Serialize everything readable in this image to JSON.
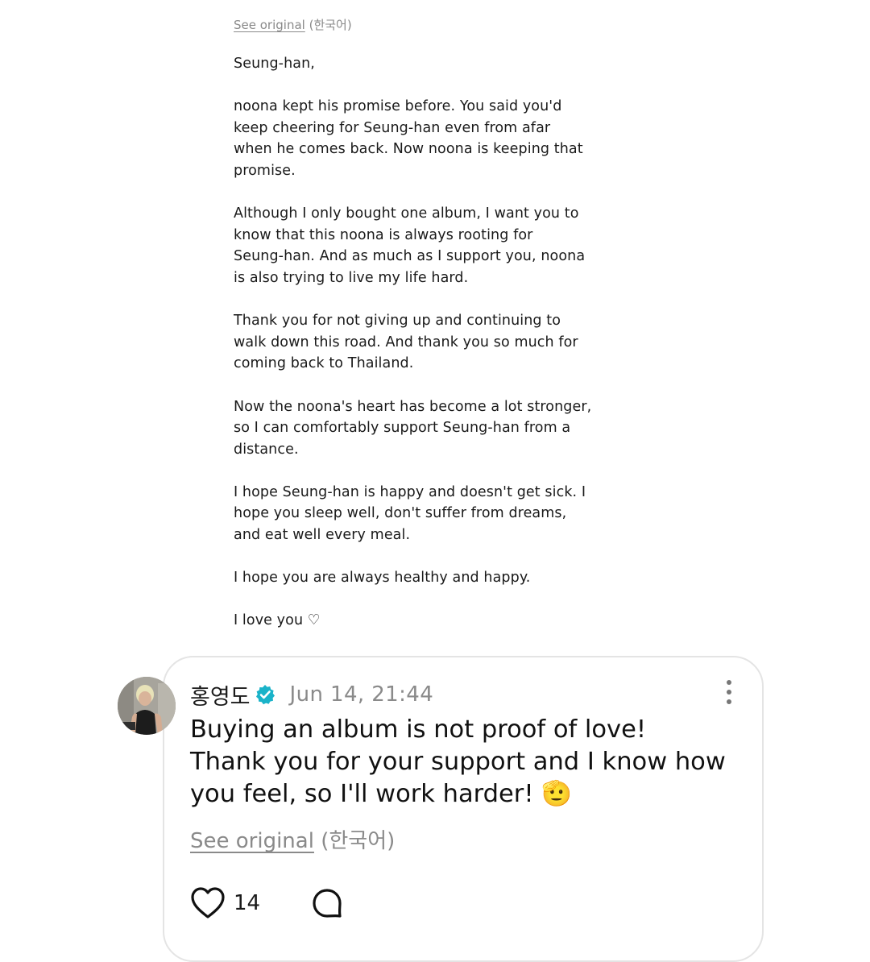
{
  "top_post": {
    "see_original_label": "See original",
    "original_language": "(한국어)",
    "paragraphs": [
      "Seung-han,",
      "noona kept his promise before. You said you'd\nkeep cheering for Seung-han even from afar\nwhen he comes back. Now noona is keeping that\npromise.",
      "Although I only bought one album, I want you to\nknow that this noona is always rooting for\nSeung-han. And as much as I support you, noona\nis also trying to live my life hard.",
      "Thank you for not giving up and continuing to\nwalk down this road. And thank you so much for\ncoming back to Thailand.",
      "Now the noona's heart has become a lot stronger,\nso I can comfortably support Seung-han from a\ndistance.",
      "I hope Seung-han is happy and doesn't get sick. I\nhope you sleep well, don't suffer from dreams,\nand eat well every meal.",
      "I hope you are always healthy and happy.",
      "I love you ♡"
    ]
  },
  "reply": {
    "author": "홍영도",
    "verified_icon": "verified-badge-icon",
    "verified_color": "#1ab3c9",
    "timestamp": "Jun 14, 21:44",
    "text": "Buying an album is not proof of love!\nThank you for your support and I know how\nyou feel, so I'll work harder! 🫡",
    "see_original_label": "See original",
    "original_language": "(한국어)",
    "like_count": "14",
    "icons": {
      "like": "heart-icon",
      "comment": "comment-bubble-icon",
      "more": "more-vertical-icon"
    }
  }
}
